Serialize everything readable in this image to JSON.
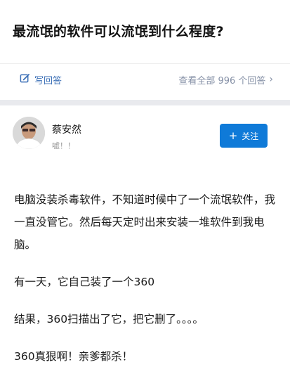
{
  "question": {
    "title": "最流氓的软件可以流氓到什么程度?",
    "write_answer_label": "写回答",
    "write_answer_icon": "edit-icon",
    "view_all_label": "查看全部 996 个回答",
    "view_all_icon": "chevron-right-icon"
  },
  "answer": {
    "author_name": "蔡安然",
    "author_bio": "嘘！！",
    "follow_label": "关注",
    "follow_icon": "plus-icon",
    "paragraphs": [
      "电脑没装杀毒软件，不知道时候中了一个流氓软件，我一直没管它。然后每天定时出来安装一堆软件到我电脑。",
      "有一天，它自己装了一个360",
      "结果，360扫描出了它，把它删了。。。。",
      "360真狠啊！亲爹都杀！"
    ]
  },
  "colors": {
    "accent": "#3b6fb6",
    "follow_button": "#0f7ad8",
    "muted_text": "#8590a6",
    "background": "#e9eaee"
  }
}
